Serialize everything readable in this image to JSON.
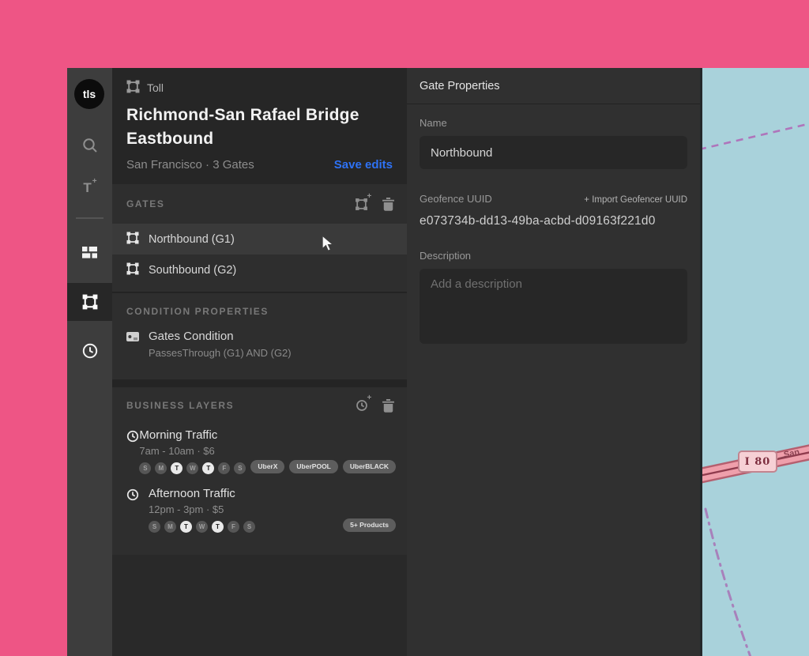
{
  "colors": {
    "background_pink": "#ee5585",
    "accent_blue": "#2e72f5",
    "sidebar_gray": "#3d3d3d",
    "panel_dark": "#292929",
    "panel_light": "#303030",
    "map_water": "#a9d2db",
    "map_road_fill": "#ef9fab",
    "map_road_casing": "#b55f6f",
    "map_boundary_purple": "#b06cb8",
    "selected_row": "#3a3a3a"
  },
  "sidebar": {
    "logo": "tls",
    "text_tool_label": "T",
    "text_tool_plus": "+",
    "items": [
      "search",
      "text-tool",
      "dashboard",
      "gates",
      "history"
    ],
    "active_item": "gates"
  },
  "toll_panel": {
    "type_label": "Toll",
    "title": "Richmond-San Rafael Bridge Eastbound",
    "subtitle": "San Francisco · 3 Gates",
    "save_button": "Save edits",
    "gates": {
      "header": "GATES",
      "items": [
        {
          "label": "Northbound (G1)",
          "selected": true
        },
        {
          "label": "Southbound (G2)",
          "selected": false
        }
      ]
    },
    "conditions": {
      "header": "CONDITION PROPERTIES",
      "items": [
        {
          "title": "Gates Condition",
          "rule": "PassesThrough (G1) AND (G2)"
        }
      ]
    },
    "business_layers": {
      "header": "BUSINESS LAYERS",
      "plus_mark": "+",
      "items": [
        {
          "title": "Morning Traffic",
          "schedule": "7am - 10am · $6",
          "days": [
            "S",
            "M",
            "T",
            "W",
            "T",
            "F",
            "S"
          ],
          "active_days": [
            2,
            4
          ],
          "tags": [
            "UberX",
            "UberPOOL",
            "UberBLACK"
          ]
        },
        {
          "title": "Afternoon Traffic",
          "schedule": "12pm - 3pm · $5",
          "days": [
            "S",
            "M",
            "T",
            "W",
            "T",
            "F",
            "S"
          ],
          "active_days": [
            2,
            4
          ],
          "tags": [
            "5+ Products"
          ]
        }
      ]
    }
  },
  "gate_properties": {
    "header": "Gate Properties",
    "name_label": "Name",
    "name_value": "Northbound",
    "uuid_label": "Geofence UUID",
    "import_link": "+ Import Geofencer UUID",
    "uuid_value": "e073734b-dd13-49ba-acbd-d09163f221d0",
    "description_label": "Description",
    "description_placeholder": "Add a description"
  },
  "map": {
    "shield_label": "I 80",
    "road_label": "San"
  }
}
